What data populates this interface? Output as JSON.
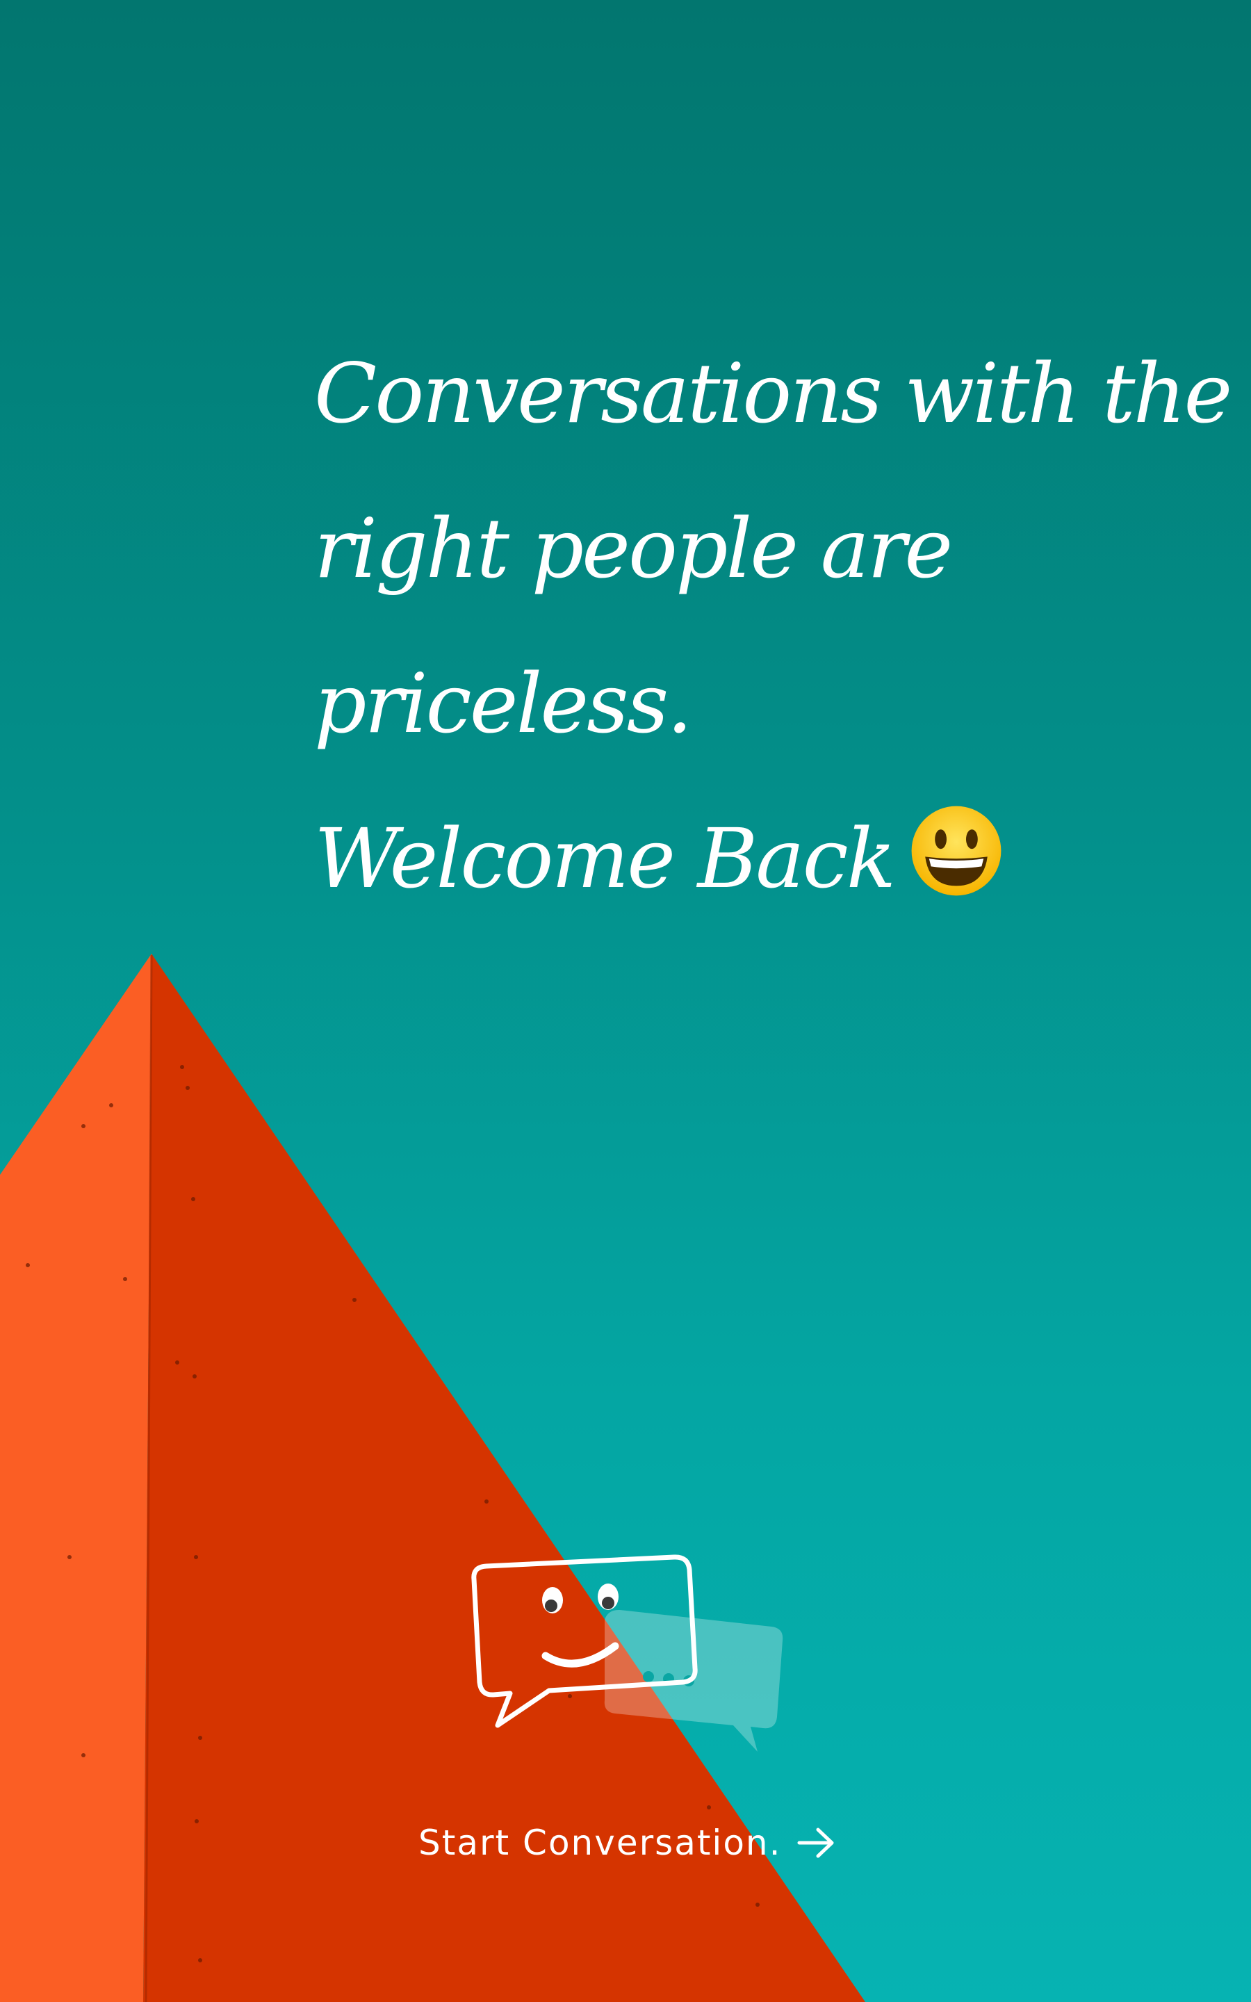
{
  "headline": {
    "line1": "Conversations with the",
    "line2": "right people are",
    "line3": "priceless.",
    "line4": "Welcome Back"
  },
  "emoji": "grinning-face-icon",
  "cta": {
    "label": "Start Conversation.",
    "icon": "arrow-right-icon"
  },
  "logo": "chat-bubble-smiley-icon",
  "colors": {
    "sky_top": "#02766f",
    "sky_bottom": "#06b3b2",
    "pyramid_light": "#fb5e24",
    "pyramid_dark": "#d53400",
    "text": "#ffffff"
  }
}
